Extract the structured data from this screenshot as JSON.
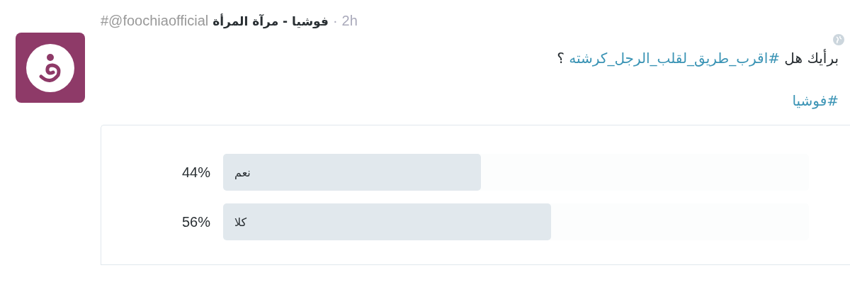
{
  "tweet": {
    "handle": "#@foochiaofficial",
    "name": "فوشيا - مرآة المرأة",
    "separator": "·",
    "time": "2h",
    "text": {
      "before": "برأيك هل",
      "hashtag": "#اقرب_طريق_لقلب_الرجل_كرشته",
      "after": "؟"
    },
    "tags": [
      "#فوشيا"
    ]
  },
  "poll": {
    "options": [
      {
        "label": "نعم",
        "percent": "44%",
        "level": 0.44
      },
      {
        "label": "كلا",
        "percent": "56%",
        "level": 0.56
      }
    ]
  }
}
